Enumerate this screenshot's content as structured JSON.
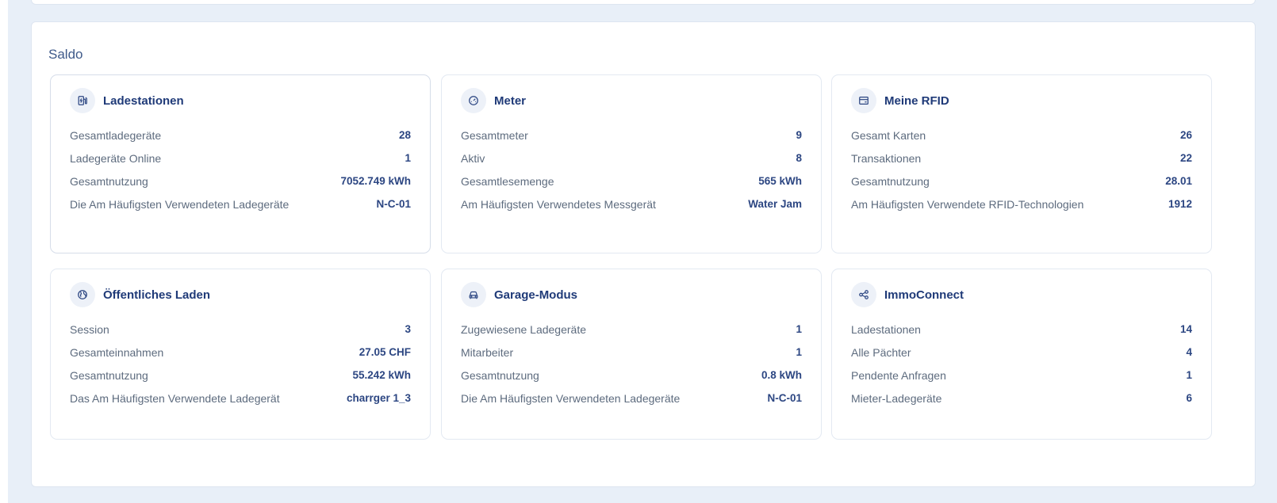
{
  "section": {
    "title": "Saldo"
  },
  "cards": [
    {
      "title": "Ladestationen",
      "icon": "ev-station-icon",
      "rows": [
        {
          "label": "Gesamtladegeräte",
          "value": "28"
        },
        {
          "label": "Ladegeräte Online",
          "value": "1"
        },
        {
          "label": "Gesamtnutzung",
          "value": "7052.749 kWh"
        },
        {
          "label": "Die Am Häufigsten Verwendeten Ladegeräte",
          "value": "N-C-01"
        }
      ]
    },
    {
      "title": "Meter",
      "icon": "gauge-icon",
      "rows": [
        {
          "label": "Gesamtmeter",
          "value": "9"
        },
        {
          "label": "Aktiv",
          "value": "8"
        },
        {
          "label": "Gesamtlesemenge",
          "value": "565 kWh"
        },
        {
          "label": "Am Häufigsten Verwendetes Messgerät",
          "value": "Water Jam"
        }
      ]
    },
    {
      "title": "Meine RFID",
      "icon": "card-icon",
      "rows": [
        {
          "label": "Gesamt Karten",
          "value": "26"
        },
        {
          "label": "Transaktionen",
          "value": "22"
        },
        {
          "label": "Gesamtnutzung",
          "value": "28.01"
        },
        {
          "label": "Am Häufigsten Verwendete RFID-Technologien",
          "value": "1912"
        }
      ]
    },
    {
      "title": "Öffentliches Laden",
      "icon": "globe-icon",
      "rows": [
        {
          "label": "Session",
          "value": "3"
        },
        {
          "label": "Gesamteinnahmen",
          "value": "27.05 CHF"
        },
        {
          "label": "Gesamtnutzung",
          "value": "55.242 kWh"
        },
        {
          "label": "Das Am Häufigsten Verwendete Ladegerät",
          "value": "charrger 1_3"
        }
      ]
    },
    {
      "title": "Garage-Modus",
      "icon": "car-icon",
      "rows": [
        {
          "label": "Zugewiesene Ladegeräte",
          "value": "1"
        },
        {
          "label": "Mitarbeiter",
          "value": "1"
        },
        {
          "label": "Gesamtnutzung",
          "value": "0.8 kWh"
        },
        {
          "label": "Die Am Häufigsten Verwendeten Ladegeräte",
          "value": "N-C-01"
        }
      ]
    },
    {
      "title": "ImmoConnect",
      "icon": "share-icon",
      "rows": [
        {
          "label": "Ladestationen",
          "value": "14"
        },
        {
          "label": "Alle Pächter",
          "value": "4"
        },
        {
          "label": "Pendente Anfragen",
          "value": "1"
        },
        {
          "label": "Mieter-Ladegeräte",
          "value": "6"
        }
      ]
    }
  ],
  "colors": {
    "accent": "#1f3a78",
    "value": "#2c4682",
    "label": "#5d6b7e",
    "background": "#e8eff8"
  }
}
